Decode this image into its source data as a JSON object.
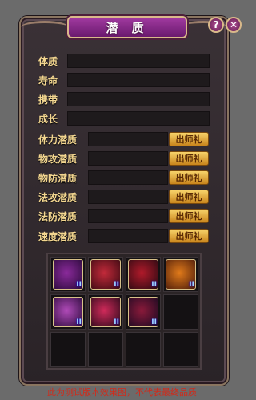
{
  "window": {
    "title": "潜 质",
    "help_label": "?",
    "close_label": "✕"
  },
  "info_fields": [
    {
      "label": "体质"
    },
    {
      "label": "寿命"
    },
    {
      "label": "携带"
    },
    {
      "label": "成长"
    }
  ],
  "potentials": [
    {
      "label": "体力潜质",
      "button": "出师礼"
    },
    {
      "label": "物攻潜质",
      "button": "出师礼"
    },
    {
      "label": "物防潜质",
      "button": "出师礼"
    },
    {
      "label": "法攻潜质",
      "button": "出师礼"
    },
    {
      "label": "法防潜质",
      "button": "出师礼"
    },
    {
      "label": "速度潜质",
      "button": "出师礼"
    }
  ],
  "skills": [
    {
      "icon": "purple-slash-skill-icon",
      "tag": "II",
      "colors": [
        "#8a2a9a",
        "#2a0a3a"
      ]
    },
    {
      "icon": "red-claw-skill-icon",
      "tag": "II",
      "colors": [
        "#c22a3a",
        "#3a0a12"
      ]
    },
    {
      "icon": "blood-drop-skill-icon",
      "tag": "II",
      "colors": [
        "#b01a2a",
        "#2a0a12"
      ]
    },
    {
      "icon": "fire-fist-skill-icon",
      "tag": "II",
      "colors": [
        "#e07a1a",
        "#4a1a0a"
      ]
    },
    {
      "icon": "shield-skill-icon",
      "tag": "II",
      "colors": [
        "#b04ab8",
        "#2a0a3a"
      ]
    },
    {
      "icon": "phoenix-skill-icon",
      "tag": "II",
      "colors": [
        "#d02a5a",
        "#2a0a1a"
      ]
    },
    {
      "icon": "comet-skill-icon",
      "tag": "II",
      "colors": [
        "#8a1a3a",
        "#1a0a22"
      ]
    }
  ],
  "empty_slots": 5,
  "footer_note": "此为测试版本效果图，不代表最终品质"
}
